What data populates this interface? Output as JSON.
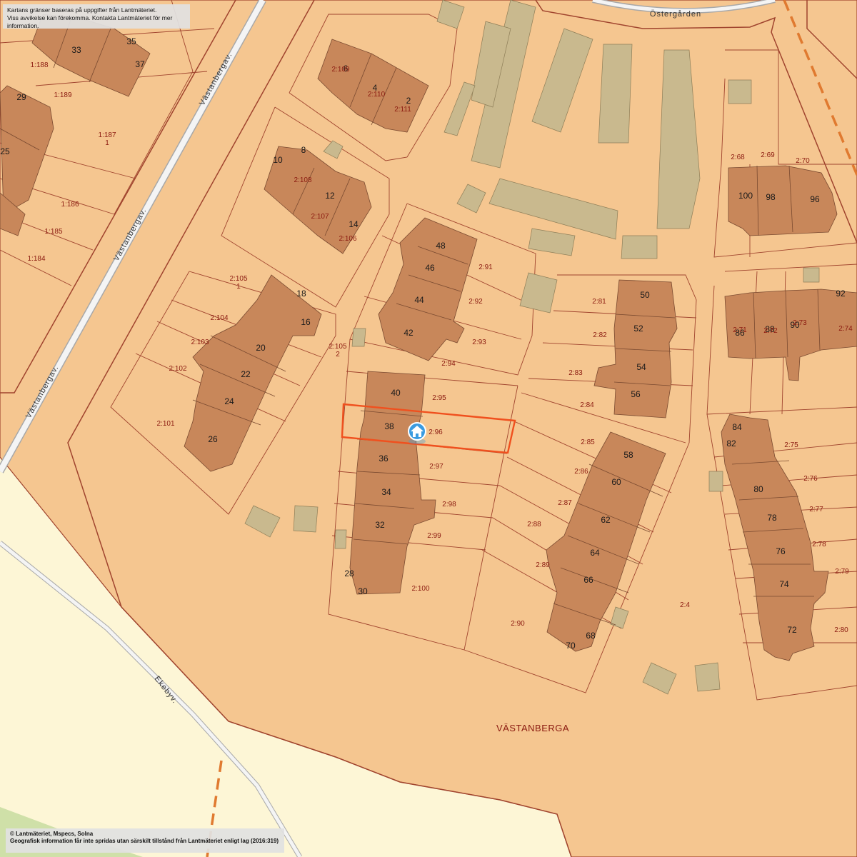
{
  "map": {
    "area_name": "VÄSTANBERGA",
    "roads": [
      "Östergården",
      "Västanbergav.",
      "Västanbergav.",
      "Västanbergav.",
      "Ekebyv."
    ],
    "house_numbers": [
      "33",
      "35",
      "37",
      "29",
      "25",
      "10",
      "8",
      "12",
      "14",
      "6",
      "4",
      "2",
      "48",
      "46",
      "44",
      "42",
      "18",
      "16",
      "20",
      "22",
      "24",
      "26",
      "40",
      "38",
      "36",
      "34",
      "32",
      "28",
      "30",
      "50",
      "52",
      "54",
      "56",
      "58",
      "60",
      "62",
      "64",
      "66",
      "68",
      "70",
      "100",
      "98",
      "96",
      "92",
      "86",
      "88",
      "90",
      "84",
      "82",
      "80",
      "78",
      "76",
      "74",
      "72"
    ],
    "parcels": [
      "1:188",
      "1:189",
      "1:187",
      "1",
      "1:186",
      "1:185",
      "1:184",
      "2:109",
      "2:110",
      "2:111",
      "2:108",
      "2:107",
      "2:106",
      "2:105",
      "1",
      "2:104",
      "2:103",
      "2:102",
      "2:101",
      "2:105",
      "2",
      "2:91",
      "2:92",
      "2:93",
      "2:94",
      "2:95",
      "2:96",
      "2:97",
      "2:98",
      "2:99",
      "2:100",
      "2:81",
      "2:82",
      "2:83",
      "2:84",
      "2:85",
      "2:86",
      "2:87",
      "2:88",
      "2:89",
      "2:90",
      "2:4",
      "2:68",
      "2:69",
      "2:70",
      "2:71",
      "2:72",
      "2:73",
      "2:74",
      "2:75",
      "2:76",
      "2:77",
      "2:78",
      "2:79",
      "2:80"
    ],
    "selected_parcel": "2:96",
    "marker_icon": "home-marker-icon"
  },
  "disclaimer": {
    "line1": "Kartans gränser baseras på uppgifter från Lantmäteriet.",
    "line2": "Viss avvikelse kan förekomma. Kontakta Lantmäteriet för mer information."
  },
  "credits": {
    "line1": "© Lantmäteriet, Mspecs, Solna",
    "line2": "Geografisk information får inte spridas utan särskilt tillstånd från Lantmäteriet enligt lag (2016:319)"
  },
  "colors": {
    "plot": "#f5c690",
    "building": "#c8875a",
    "outbuilding": "#c9b98e",
    "background": "#fdf6d6",
    "boundary": "#a0442e",
    "selected": "#f0501e",
    "railway": "#e07a30"
  }
}
